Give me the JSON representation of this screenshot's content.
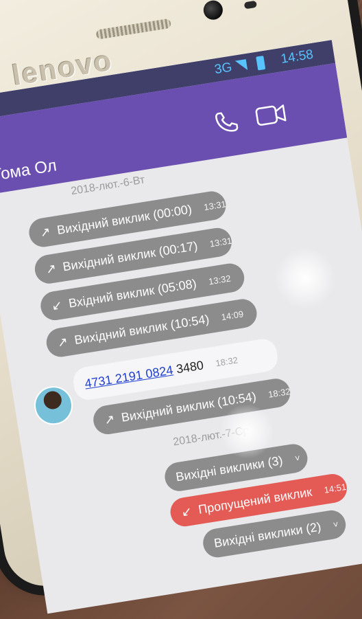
{
  "device": {
    "brand": "lenovo"
  },
  "status_bar": {
    "network": "3G",
    "time": "14:58"
  },
  "app_bar": {
    "contact_name": "Тома Ол",
    "call_icon": "phone-icon",
    "video_icon": "video-camera-icon"
  },
  "messages": [
    {
      "type": "date",
      "text": "2018-лют.-6-Вт"
    },
    {
      "type": "call",
      "arrow": "↗",
      "label": "Вихідний виклик (00:00)",
      "time": "13:31"
    },
    {
      "type": "call",
      "arrow": "↗",
      "label": "Вихідний виклик (00:17)",
      "time": "13:31"
    },
    {
      "type": "call",
      "arrow": "↙",
      "label": "Вхідний виклик (05:08)",
      "time": "13:32"
    },
    {
      "type": "call",
      "arrow": "↗",
      "label": "Вихідний виклик (10:54)",
      "time": "14:09"
    },
    {
      "type": "text",
      "linked": "4731 2191 0824",
      "rest": "3480",
      "time": "18:32"
    },
    {
      "type": "call",
      "arrow": "↗",
      "label": "Вихідний виклик (10:54)",
      "time": "18:32"
    },
    {
      "type": "date",
      "text": "2018-лют.-7-Ср"
    },
    {
      "type": "group",
      "label": "Вихідні виклики (3)",
      "chevron": "˅"
    },
    {
      "type": "missed",
      "arrow": "↙",
      "label": "Пропущений виклик",
      "time": "14:51"
    },
    {
      "type": "group",
      "label": "Вихідні виклики (2)",
      "chevron": "˅"
    }
  ]
}
